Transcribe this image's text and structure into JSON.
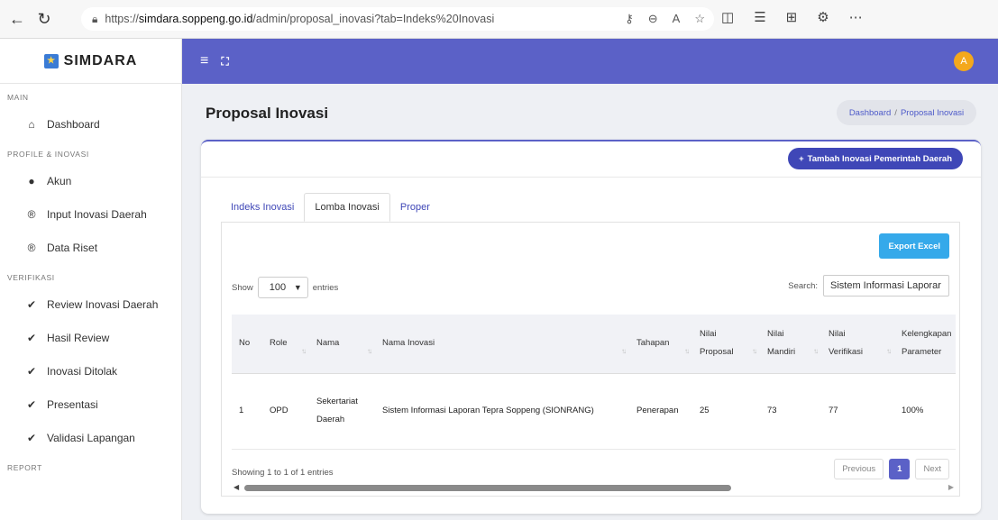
{
  "browser": {
    "url_prefix": "https://",
    "url_host": "simdara.soppeng.go.id",
    "url_path": "/admin/proposal_inovasi?tab=Indeks%20Inovasi"
  },
  "brand": {
    "name": "SIMDARA"
  },
  "sidebar": {
    "sections": [
      {
        "title": "MAIN",
        "items": [
          {
            "label": "Dashboard",
            "icon": "home-icon"
          }
        ]
      },
      {
        "title": "PROFILE & INOVASI",
        "items": [
          {
            "label": "Akun",
            "icon": "user-icon"
          },
          {
            "label": "Input Inovasi Daerah",
            "icon": "circle-r-icon"
          },
          {
            "label": "Data Riset",
            "icon": "circle-r-icon"
          }
        ]
      },
      {
        "title": "VERIFIKASI",
        "items": [
          {
            "label": "Review Inovasi Daerah",
            "icon": "check-double-icon"
          },
          {
            "label": "Hasil Review",
            "icon": "check-double-icon"
          },
          {
            "label": "Inovasi Ditolak",
            "icon": "check-double-icon"
          },
          {
            "label": "Presentasi",
            "icon": "check-double-icon"
          },
          {
            "label": "Validasi Lapangan",
            "icon": "check-double-icon"
          }
        ]
      },
      {
        "title": "REPORT",
        "items": []
      }
    ]
  },
  "topbar": {
    "avatar_initial": "A"
  },
  "page": {
    "title": "Proposal Inovasi",
    "breadcrumb": [
      "Dashboard",
      "Proposal Inovasi"
    ],
    "add_button": "Tambah Inovasi Pemerintah Daerah"
  },
  "tabs": [
    {
      "label": "Indeks Inovasi",
      "active": false
    },
    {
      "label": "Lomba Inovasi",
      "active": true
    },
    {
      "label": "Proper",
      "active": false
    }
  ],
  "table_controls": {
    "export_label": "Export Excel",
    "show_label": "Show",
    "entries_value": "100",
    "entries_label": "entries",
    "search_label": "Search:",
    "search_value": "Sistem Informasi Laporar"
  },
  "table": {
    "columns": [
      "No",
      "Role",
      "Nama",
      "Nama Inovasi",
      "Tahapan",
      "Nilai Proposal",
      "Nilai Mandiri",
      "Nilai Verifikasi",
      "Kelengkapan Parameter"
    ],
    "rows": [
      [
        "1",
        "OPD",
        "Sekertariat Daerah",
        "Sistem Informasi Laporan Tepra Soppeng (SIONRANG)",
        "Penerapan",
        "25",
        "73",
        "77",
        "100%"
      ]
    ]
  },
  "pagination": {
    "info": "Showing 1 to 1 of 1 entries",
    "previous": "Previous",
    "current": "1",
    "next": "Next"
  }
}
